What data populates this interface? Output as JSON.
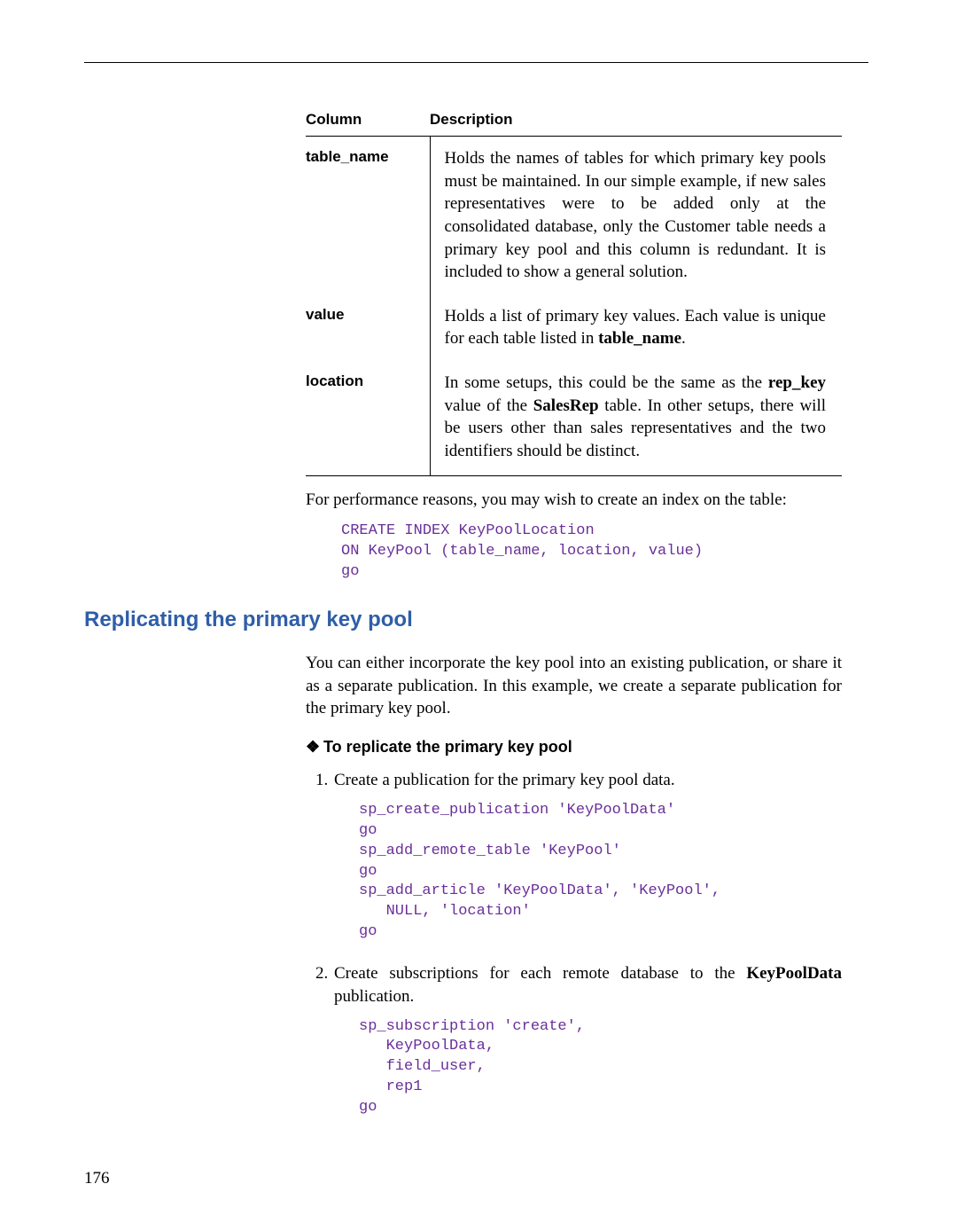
{
  "table": {
    "headers": {
      "col": "Column",
      "desc": "Description"
    },
    "rows": [
      {
        "col": "table_name",
        "desc_parts": [
          {
            "t": "Holds the names of tables for which primary key pools must be maintained. In our simple example, if new sales representatives were to be added only at the consolidated database, only the Customer table needs a primary key pool and this column is redundant. It is included to show a general solution."
          }
        ]
      },
      {
        "col": "value",
        "desc_parts": [
          {
            "t": "Holds a list of primary key values. Each value is unique for each table listed in "
          },
          {
            "t": "table_name",
            "b": true
          },
          {
            "t": "."
          }
        ]
      },
      {
        "col": "location",
        "desc_parts": [
          {
            "t": "In some setups, this could be the same as the "
          },
          {
            "t": "rep_key",
            "b": true
          },
          {
            "t": " value of the "
          },
          {
            "t": "SalesRep",
            "b": true
          },
          {
            "t": " table. In other setups, there will be users other than sales representatives and the two identifiers should be distinct."
          }
        ]
      }
    ]
  },
  "after_table_para": "For performance reasons, you may wish to create an index on the table:",
  "code1": "CREATE INDEX KeyPoolLocation\nON KeyPool (table_name, location, value)\ngo",
  "section_heading": "Replicating the primary key pool",
  "section_intro": "You can either incorporate the key pool into an existing publication, or share it as a separate publication. In this example, we create a separate publication for the primary key pool.",
  "proc_heading_glyph": "❖",
  "proc_heading": "To replicate the primary key pool",
  "steps": [
    {
      "text_parts": [
        {
          "t": "Create a publication for the primary key pool data."
        }
      ],
      "code": "sp_create_publication 'KeyPoolData'\ngo\nsp_add_remote_table 'KeyPool'\ngo\nsp_add_article 'KeyPoolData', 'KeyPool',\n   NULL, 'location'\ngo"
    },
    {
      "text_parts": [
        {
          "t": "Create subscriptions for each remote database to the "
        },
        {
          "t": "KeyPoolData",
          "b": true
        },
        {
          "t": " publication."
        }
      ],
      "code": "sp_subscription 'create',\n   KeyPoolData,\n   field_user,\n   rep1\ngo"
    }
  ],
  "page_number": "176"
}
